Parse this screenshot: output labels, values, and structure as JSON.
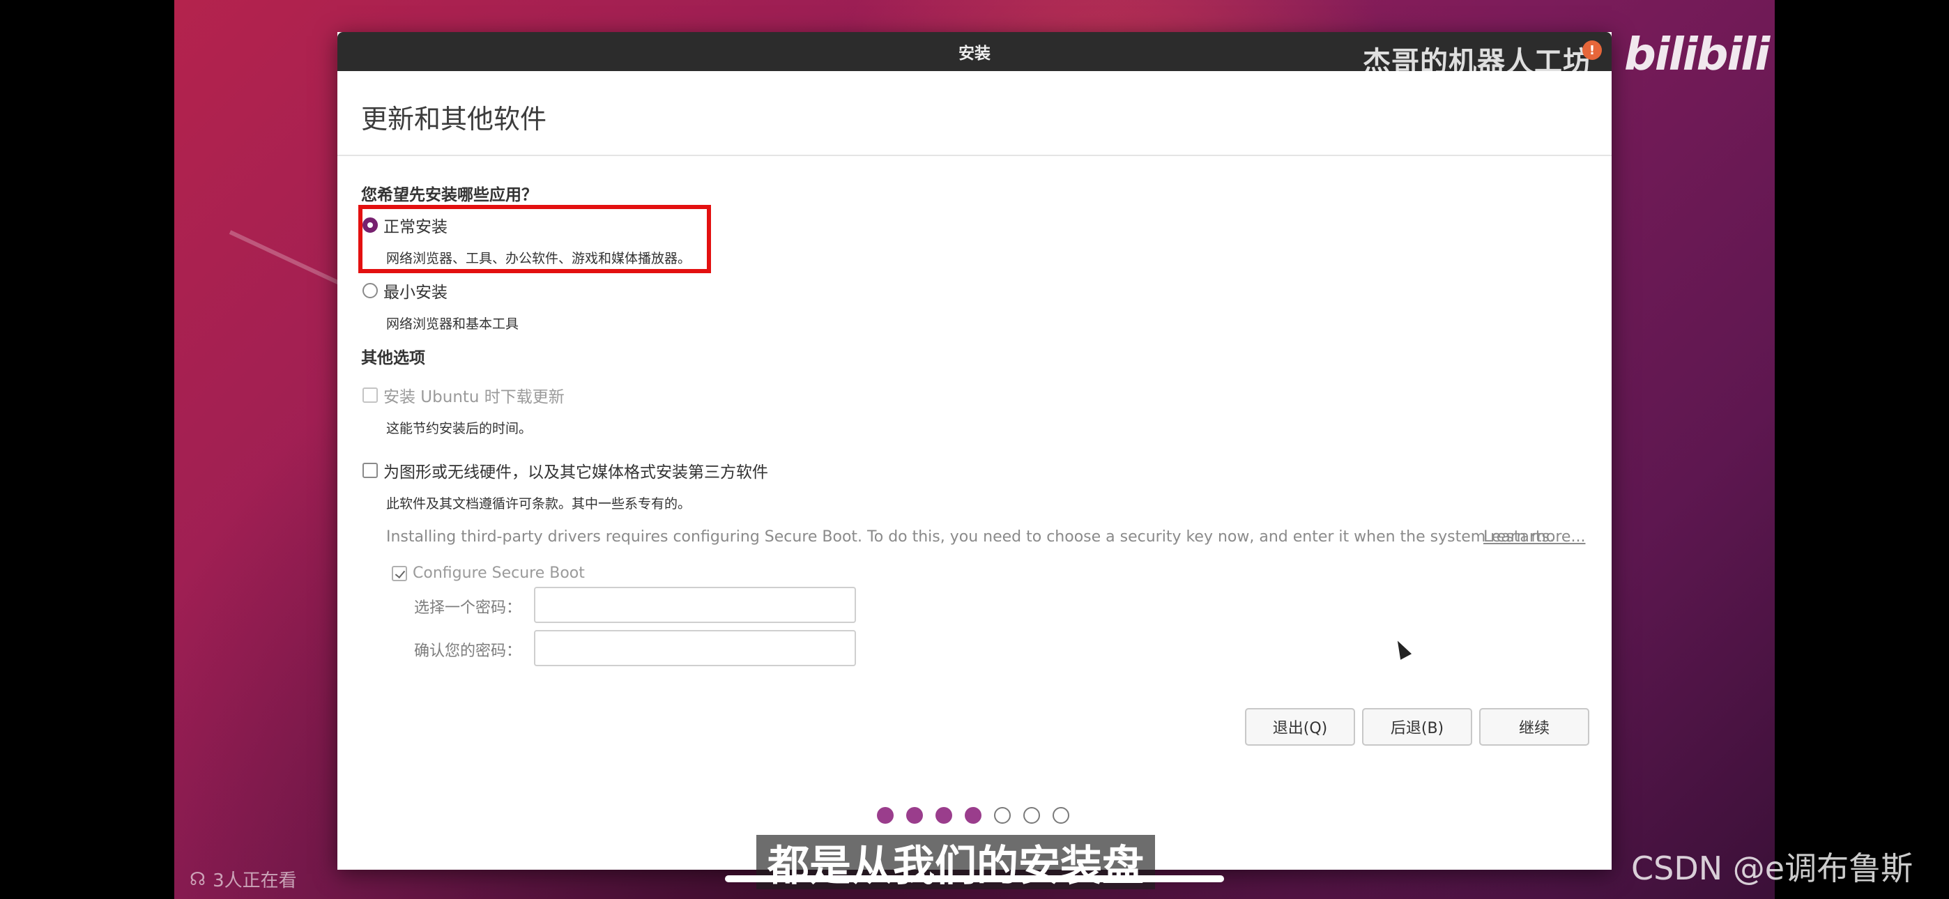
{
  "window": {
    "title": "安装"
  },
  "page": {
    "heading": "更新和其他软件",
    "question": "您希望先安装哪些应用？",
    "options": [
      {
        "label": "正常安装",
        "description": "网络浏览器、工具、办公软件、游戏和媒体播放器。",
        "selected": true
      },
      {
        "label": "最小安装",
        "description": "网络浏览器和基本工具",
        "selected": false
      }
    ],
    "other_heading": "其他选项",
    "update_option": {
      "label": "安装 Ubuntu 时下载更新",
      "description": "这能节约安装后的时间。",
      "checked": false,
      "disabled": true
    },
    "thirdparty_option": {
      "label": "为图形或无线硬件，以及其它媒体格式安装第三方软件",
      "description": "此软件及其文档遵循许可条款。其中一些系专有的。",
      "checked": false
    },
    "secure_boot_note": "Installing third-party drivers requires configuring Secure Boot. To do this, you need to choose a security key now, and enter it when the system restarts.",
    "learn_more": "Learn more...",
    "configure_secure_boot": {
      "label": "Configure Secure Boot",
      "checked": true,
      "disabled": true
    },
    "password_label": "选择一个密码：",
    "confirm_password_label": "确认您的密码：",
    "password_value": "",
    "confirm_password_value": ""
  },
  "buttons": {
    "quit": "退出(Q)",
    "back": "后退(B)",
    "continue": "继续"
  },
  "progress_steps": {
    "total": 7,
    "completed": 4
  },
  "overlay": {
    "watermark": "杰哥的机器人工坊",
    "bili_logo": "bilibili",
    "subtitle": "都是从我们的安装盘",
    "viewers": "3人正在看",
    "csdn": "CSDN @e调布鲁斯"
  },
  "colors": {
    "accent": "#77216f",
    "highlight_box": "#e31010",
    "titlebar": "#2c2c2c"
  }
}
